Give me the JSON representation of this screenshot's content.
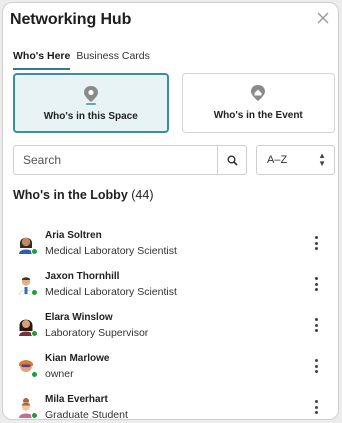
{
  "header": {
    "title": "Networking Hub",
    "close_icon": "close-icon"
  },
  "tabs": [
    {
      "label": "Who's Here",
      "active": true
    },
    {
      "label": "Business Cards",
      "active": false
    }
  ],
  "views": [
    {
      "label": "Who's in this Space",
      "icon": "location-pin-icon",
      "active": true
    },
    {
      "label": "Who's in the Event",
      "icon": "location-pin-icon",
      "active": false
    }
  ],
  "search": {
    "placeholder": "Search",
    "value": ""
  },
  "sort": {
    "value": "A–Z"
  },
  "lobby": {
    "title": "Who's in the Lobby",
    "count": "(44)"
  },
  "attendees": [
    {
      "name": "Aria Soltren",
      "role": "Medical Laboratory Scientist",
      "online": true
    },
    {
      "name": "Jaxon Thornhill",
      "role": "Medical Laboratory Scientist",
      "online": true
    },
    {
      "name": "Elara Winslow",
      "role": "Laboratory Supervisor",
      "online": true
    },
    {
      "name": "Kian Marlowe",
      "role": "owner",
      "online": true
    },
    {
      "name": "Mila Everhart",
      "role": "Graduate Student",
      "online": true
    }
  ],
  "colors": {
    "accent": "#3b8ea2",
    "active_card_bg": "#e8f3f6",
    "online": "#1f9d3a"
  }
}
